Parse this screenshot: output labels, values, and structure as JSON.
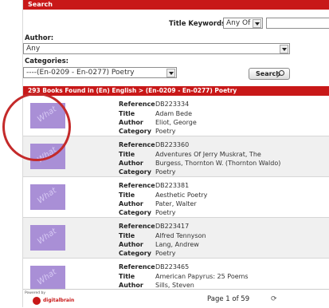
{
  "header": {
    "title": "Search"
  },
  "form": {
    "title_keywords_label": "Title Keywords:",
    "title_keywords_mode": "Any Of",
    "title_keywords_value": "",
    "author_label": "Author:",
    "author_value": "Any",
    "categories_label": "Categories:",
    "category_value": "----(En-0209 - En-0277) Poetry",
    "search_label": "Search"
  },
  "results_bar": "293 Books Found in (En) English > (En-0209 - En-0277) Poetry",
  "field_labels": {
    "reference": "Reference",
    "title": "Title",
    "author": "Author",
    "category": "Category"
  },
  "thumb_text": "What",
  "records": [
    {
      "reference": "DB223334",
      "title": "Adam Bede",
      "author": "Eliot, George",
      "category": "Poetry"
    },
    {
      "reference": "DB223360",
      "title": "Adventures Of Jerry Muskrat, The",
      "author": "Burgess, Thornton W. (Thornton Waldo)",
      "category": "Poetry"
    },
    {
      "reference": "DB223381",
      "title": "Aesthetic Poetry",
      "author": "Pater, Walter",
      "category": "Poetry"
    },
    {
      "reference": "DB223417",
      "title": "Alfred Tennyson",
      "author": "Lang, Andrew",
      "category": "Poetry"
    },
    {
      "reference": "DB223465",
      "title": "American Papyrus: 25 Poems",
      "author": "Sills, Steven",
      "category": "Poetry"
    }
  ],
  "footer": {
    "powered_by": "Powered by",
    "logo_text": "digitalbrain",
    "pager": "Page 1 of 59",
    "pager_icon": "refresh-icon"
  },
  "colors": {
    "accent": "#c81818",
    "highlight_circle": "#c42a2a",
    "thumb": "#a98fd6"
  }
}
